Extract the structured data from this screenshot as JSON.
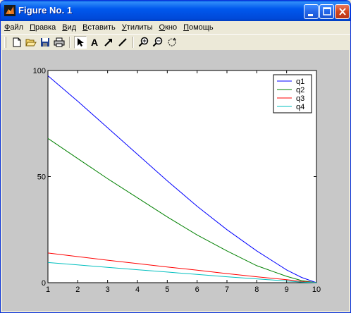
{
  "window": {
    "title": "Figure No. 1"
  },
  "menu": {
    "items": [
      {
        "ul": "Ф",
        "rest": "айл"
      },
      {
        "ul": "П",
        "rest": "равка"
      },
      {
        "ul": "В",
        "rest": "ид"
      },
      {
        "ul": "В",
        "rest": "ставить"
      },
      {
        "ul": "У",
        "rest": "тилиты"
      },
      {
        "ul": "О",
        "rest": "кно"
      },
      {
        "ul": "П",
        "rest": "омощь"
      }
    ]
  },
  "toolbar": {
    "text_tool": "A"
  },
  "colors": {
    "q1": "#0000FF",
    "q2": "#008000",
    "q3": "#FF0000",
    "q4": "#00BFBF",
    "figure_bg": "#C8C8C8"
  },
  "chart_data": {
    "type": "line",
    "title": "",
    "xlabel": "",
    "ylabel": "",
    "xlim": [
      1,
      10
    ],
    "ylim": [
      0,
      100
    ],
    "xticks": [
      "1",
      "2",
      "3",
      "4",
      "5",
      "6",
      "7",
      "8",
      "9",
      "10"
    ],
    "yticks": [
      "0",
      "50",
      "100"
    ],
    "legend_position": "top-right",
    "series": [
      {
        "name": "q1",
        "color": "#0000FF",
        "x": [
          1,
          2,
          3,
          4,
          5,
          6,
          7,
          8,
          9,
          9.5,
          10
        ],
        "y": [
          97.5,
          85.5,
          73,
          60.5,
          48,
          36,
          25,
          15,
          6,
          2.5,
          0
        ]
      },
      {
        "name": "q2",
        "color": "#008000",
        "x": [
          1,
          2,
          3,
          4,
          5,
          6,
          7,
          8,
          9,
          9.5,
          10
        ],
        "y": [
          68,
          58.5,
          49,
          40,
          31,
          22.5,
          15,
          8,
          3,
          1,
          0
        ]
      },
      {
        "name": "q3",
        "color": "#FF0000",
        "x": [
          1,
          2,
          3,
          4,
          5,
          6,
          7,
          8,
          9,
          9.5,
          10
        ],
        "y": [
          14,
          12.3,
          10.6,
          9,
          7.4,
          5.9,
          4.3,
          2.8,
          1.4,
          0.6,
          0
        ]
      },
      {
        "name": "q4",
        "color": "#00BFBF",
        "x": [
          1,
          2,
          3,
          4,
          5,
          6,
          7,
          8,
          9,
          9.5,
          10
        ],
        "y": [
          9.5,
          8.4,
          7.2,
          6.1,
          5,
          3.9,
          2.8,
          1.8,
          0.8,
          0.3,
          0
        ]
      }
    ]
  }
}
